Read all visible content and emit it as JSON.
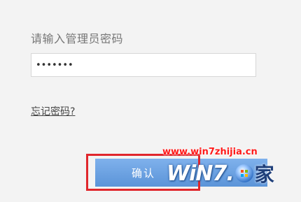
{
  "login": {
    "prompt": "请输入管理员密码",
    "password_value": "•••••••",
    "forgot_link": "忘记密码?",
    "confirm_label": "确认"
  },
  "watermark": {
    "url": "www.win7zhijia.cn",
    "logo_text": "WiN7.",
    "logo_char": "家"
  },
  "colors": {
    "highlight": "#e0262c",
    "button": "#6aa3e4",
    "background": "#f3f3f3"
  }
}
